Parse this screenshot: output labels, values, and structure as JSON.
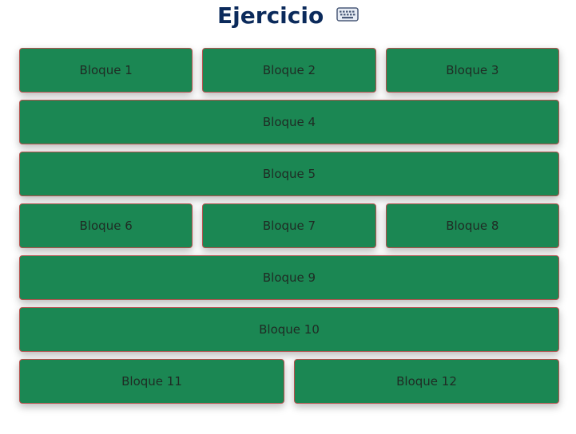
{
  "header": {
    "title": "Ejercicio",
    "icon": "keyboard-icon"
  },
  "colors": {
    "title": "#0b2a5b",
    "block_background": "#1b8753",
    "block_border": "#b5514e",
    "block_text": "#1f2b24"
  },
  "blocks": [
    {
      "label": "Bloque 1"
    },
    {
      "label": "Bloque 2"
    },
    {
      "label": "Bloque 3"
    },
    {
      "label": "Bloque 4"
    },
    {
      "label": "Bloque 5"
    },
    {
      "label": "Bloque 6"
    },
    {
      "label": "Bloque 7"
    },
    {
      "label": "Bloque 8"
    },
    {
      "label": "Bloque 9"
    },
    {
      "label": "Bloque 10"
    },
    {
      "label": "Bloque 11"
    },
    {
      "label": "Bloque 12"
    }
  ]
}
